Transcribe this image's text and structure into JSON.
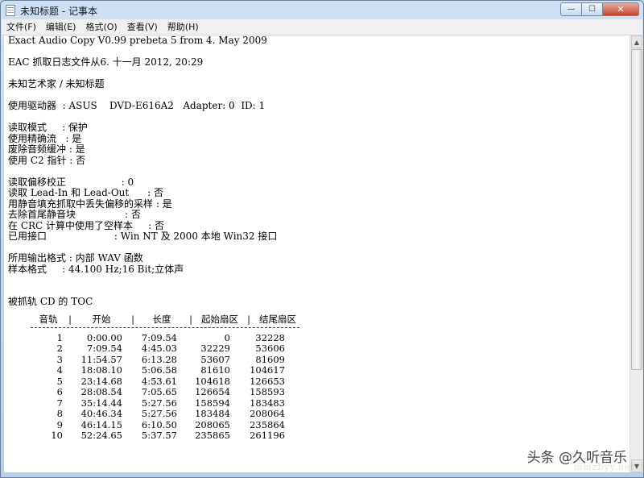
{
  "window": {
    "title": "未知标题 - 记事本"
  },
  "controls": {
    "min": "—",
    "max": "☐",
    "close": "✕"
  },
  "menu": [
    "文件(F)",
    "编辑(E)",
    "格式(O)",
    "查看(V)",
    "帮助(H)"
  ],
  "lines": [
    "Exact Audio Copy V0.99 prebeta 5 from 4. May 2009",
    "",
    "EAC 抓取日志文件从6. 十一月 2012, 20:29",
    "",
    "未知艺术家 / 未知标题",
    "",
    "使用驱动器  : ASUS    DVD-E616A2   Adapter: 0  ID: 1",
    "",
    "读取模式     : 保护",
    "使用精确流   : 是",
    "废除音频缓冲 : 是",
    "使用 C2 指针 : 否",
    "",
    "读取偏移校正                  : 0",
    "读取 Lead-In 和 Lead-Out      : 否",
    "用静音填充抓取中丢失偏移的采样 : 是",
    "去除首尾静音块                : 否",
    "在 CRC 计算中使用了空样本     : 否",
    "已用接口                      : Win NT 及 2000 本地 Win32 接口",
    "",
    "所用输出格式 : 内部 WAV 函数",
    "样本格式     : 44.100 Hz;16 Bit;立体声",
    "",
    "",
    "被抓轨 CD 的 TOC"
  ],
  "toc": {
    "headers": [
      "音轨",
      "开始",
      "长度",
      "起始扇区",
      "结尾扇区"
    ],
    "rows": [
      [
        "1",
        "0:00.00",
        "7:09.54",
        "0",
        "32228"
      ],
      [
        "2",
        "7:09.54",
        "4:45.03",
        "32229",
        "53606"
      ],
      [
        "3",
        "11:54.57",
        "6:13.28",
        "53607",
        "81609"
      ],
      [
        "4",
        "18:08.10",
        "5:06.58",
        "81610",
        "104617"
      ],
      [
        "5",
        "23:14.68",
        "4:53.61",
        "104618",
        "126653"
      ],
      [
        "6",
        "28:08.54",
        "7:05.65",
        "126654",
        "158593"
      ],
      [
        "7",
        "35:14.44",
        "5:27.56",
        "158594",
        "183483"
      ],
      [
        "8",
        "40:46.34",
        "5:27.56",
        "183484",
        "208064"
      ],
      [
        "9",
        "46:14.15",
        "6:10.50",
        "208065",
        "235864"
      ],
      [
        "10",
        "52:24.65",
        "5:37.57",
        "235865",
        "261196"
      ]
    ]
  },
  "watermark": "头条 @久听音乐",
  "watermark_faint": "mmzbyy.net"
}
